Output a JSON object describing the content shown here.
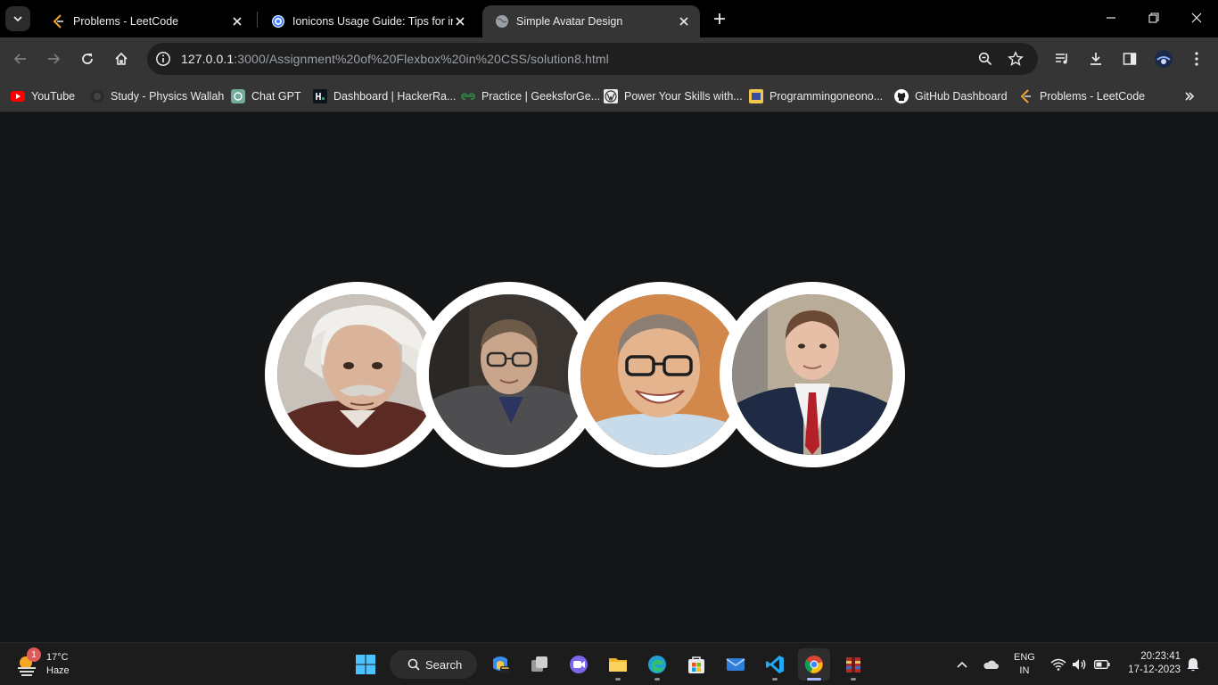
{
  "browser": {
    "tabs": [
      {
        "title": "Problems - LeetCode",
        "active": false
      },
      {
        "title": "Ionicons Usage Guide: Tips for inst",
        "active": false
      },
      {
        "title": "Simple Avatar Design",
        "active": true
      }
    ],
    "url_host": "127.0.0.1",
    "url_path": ":3000/Assignment%20of%20Flexbox%20in%20CSS/solution8.html",
    "bookmarks": [
      {
        "label": "YouTube",
        "icon": "youtube-icon"
      },
      {
        "label": "Study - Physics Wallah",
        "icon": "pw-icon"
      },
      {
        "label": "Chat GPT",
        "icon": "chatgpt-icon"
      },
      {
        "label": "Dashboard | HackerRa...",
        "icon": "hackerrank-icon"
      },
      {
        "label": "Practice | GeeksforGe...",
        "icon": "gfg-icon"
      },
      {
        "label": "Power Your Skills with...",
        "icon": "wordpress-icon"
      },
      {
        "label": "Programmingoneono...",
        "icon": "programming-icon"
      },
      {
        "label": "GitHub Dashboard",
        "icon": "github-icon"
      },
      {
        "label": "Problems - LeetCode",
        "icon": "leetcode-icon"
      }
    ]
  },
  "page": {
    "avatars": [
      {
        "name": "avatar-1",
        "bg": "#c9c2bb",
        "skin": "#d9b49a",
        "shirt": "#5a2a23"
      },
      {
        "name": "avatar-2",
        "bg": "#3a3530",
        "skin": "#c9a58c",
        "shirt": "#4e4e50"
      },
      {
        "name": "avatar-3",
        "bg": "#d2884a",
        "skin": "#e4b48f",
        "shirt": "#c7dbea"
      },
      {
        "name": "avatar-4",
        "bg": "#b9ad99",
        "skin": "#e6bfa6",
        "shirt": "#1f2a44"
      }
    ]
  },
  "taskbar": {
    "weather_temp": "17°C",
    "weather_desc": "Haze",
    "weather_badge": "1",
    "search_label": "Search",
    "lang_line1": "ENG",
    "lang_line2": "IN",
    "time": "20:23:41",
    "date": "17-12-2023"
  },
  "colors": {
    "page_bg": "#131517",
    "avatar_border": "#ffffff",
    "active_tab": "#353535"
  }
}
